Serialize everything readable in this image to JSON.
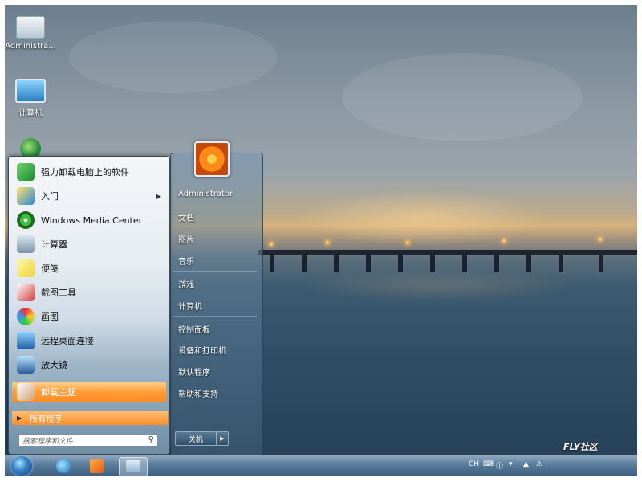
{
  "desktop": {
    "icons": [
      {
        "label": "Administra..."
      },
      {
        "label": "计算机"
      }
    ]
  },
  "start_menu": {
    "user_name": "Administrator",
    "programs": [
      {
        "label": "强力卸载电脑上的软件"
      },
      {
        "label": "入门"
      },
      {
        "label": "Windows Media Center"
      },
      {
        "label": "计算器"
      },
      {
        "label": "便笺"
      },
      {
        "label": "截图工具"
      },
      {
        "label": "画图"
      },
      {
        "label": "远程桌面连接"
      },
      {
        "label": "放大镜"
      },
      {
        "label": "卸载主题"
      }
    ],
    "all_programs": "所有程序",
    "search_placeholder": "搜索程序和文件",
    "right_items": [
      {
        "label": "文档"
      },
      {
        "label": "图片"
      },
      {
        "label": "音乐"
      },
      {
        "label": "游戏"
      },
      {
        "label": "计算机"
      },
      {
        "label": "控制面板"
      },
      {
        "label": "设备和打印机"
      },
      {
        "label": "默认程序"
      },
      {
        "label": "帮助和支持"
      }
    ],
    "shutdown_label": "关机"
  },
  "taskbar": {
    "lang": "CH"
  },
  "watermark": "FLY社区",
  "colors": {
    "highlight": "#ff9e3a",
    "taskbar": "#3c5f80"
  }
}
